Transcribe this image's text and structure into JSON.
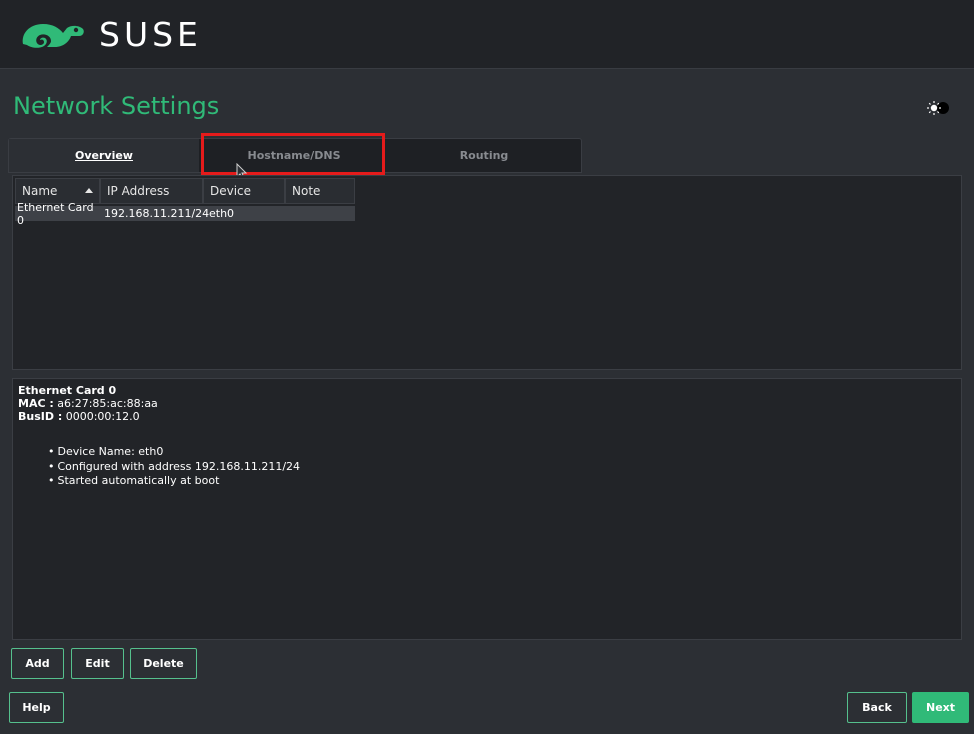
{
  "header": {
    "logo_text": "SUSE"
  },
  "page": {
    "title": "Network Settings"
  },
  "tabs": [
    {
      "label": "Overview",
      "active": true
    },
    {
      "label": "Hostname/DNS",
      "active": false
    },
    {
      "label": "Routing",
      "active": false
    }
  ],
  "table": {
    "columns": [
      "Name",
      "IP Address",
      "Device",
      "Note"
    ],
    "rows": [
      {
        "name": "Ethernet Card 0",
        "ip": "192.168.11.211/24",
        "device": "eth0",
        "note": ""
      }
    ]
  },
  "details": {
    "title": "Ethernet Card 0",
    "mac_label": "MAC :",
    "mac_value": "a6:27:85:ac:88:aa",
    "busid_label": "BusID :",
    "busid_value": "0000:00:12.0",
    "bullets": [
      "Device Name: eth0",
      "Configured with address 192.168.11.211/24",
      "Started automatically at boot"
    ]
  },
  "buttons": {
    "add": "Add",
    "edit": "Edit",
    "delete": "Delete",
    "help": "Help",
    "back": "Back",
    "next": "Next"
  },
  "colors": {
    "accent": "#30ba78",
    "highlight": "#e51b1b",
    "background": "#2c2f34"
  },
  "icons": {
    "theme_toggle": "theme-toggle-icon",
    "logo": "suse-chameleon-icon",
    "sort": "sort-ascending-icon"
  }
}
